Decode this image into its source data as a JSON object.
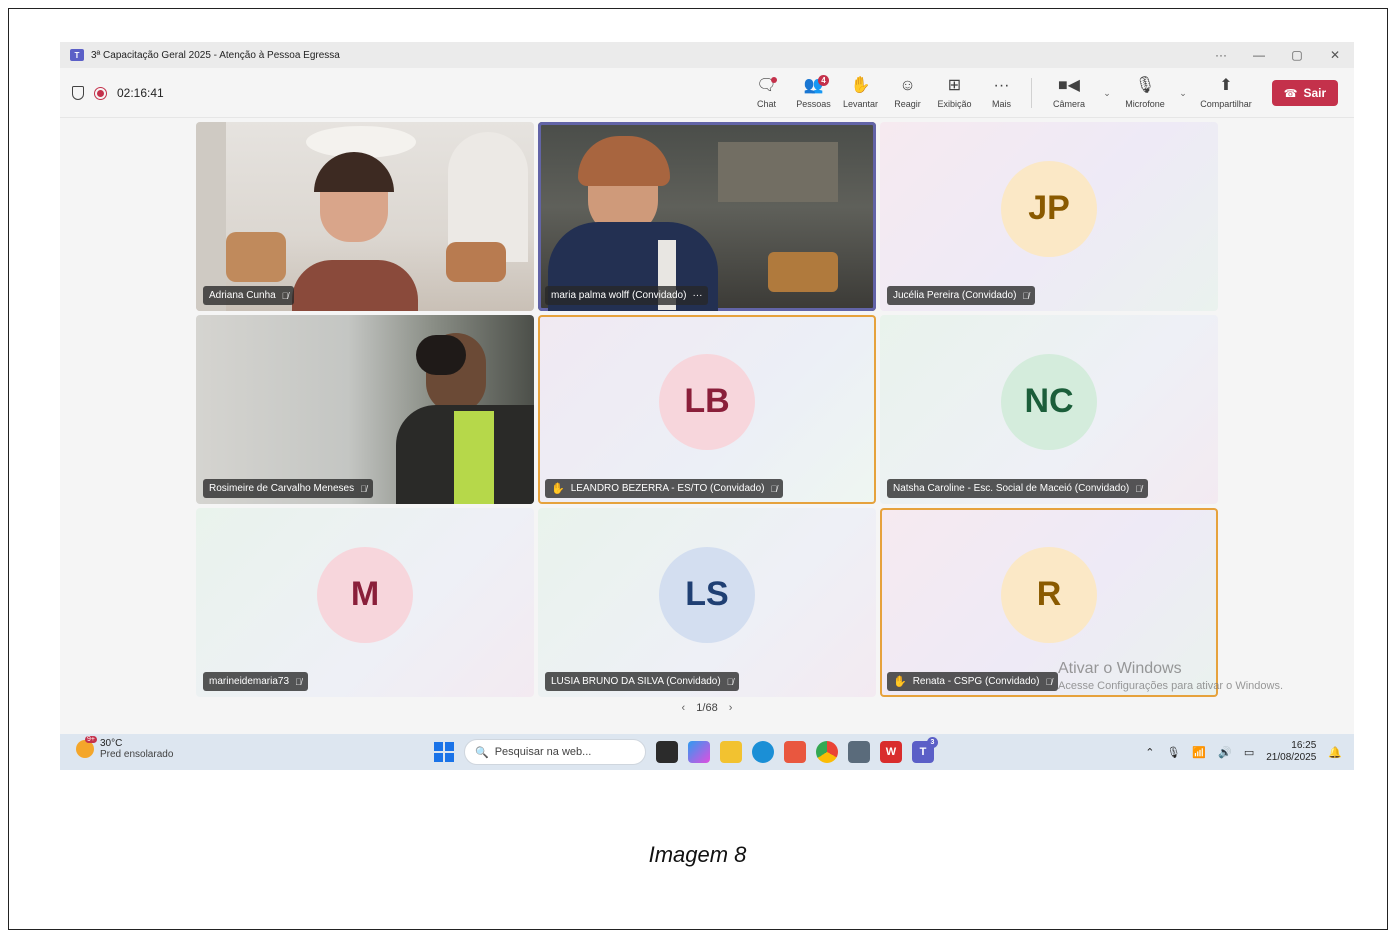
{
  "window": {
    "title": "3ª Capacitação Geral 2025 - Atenção à Pessoa Egressa",
    "controls": [
      "···",
      "—",
      "▢",
      "✕"
    ]
  },
  "meeting": {
    "timer": "02:16:41"
  },
  "toolbar": {
    "chat": "Chat",
    "people": "Pessoas",
    "people_count": "4",
    "raise": "Levantar",
    "react": "Reagir",
    "view": "Exibição",
    "more": "Mais",
    "camera": "Câmera",
    "microphone": "Microfone",
    "share": "Compartilhar",
    "leave": "Sair"
  },
  "participants": [
    {
      "name": "Adriana Cunha",
      "video": true,
      "muted": true,
      "hand": false
    },
    {
      "name": "maria palma wolff (Convidado)",
      "video": true,
      "muted": false,
      "hand": false,
      "active": true
    },
    {
      "name": "Jucélia Pereira (Convidado)",
      "initials": "JP",
      "avatar_bg": "#fbe8c6",
      "avatar_fg": "#8a5a00",
      "muted": true
    },
    {
      "name": "Rosimeire de Carvalho Meneses",
      "video": true,
      "muted": true
    },
    {
      "name": "LEANDRO BEZERRA - ES/TO (Convidado)",
      "initials": "LB",
      "avatar_bg": "#f7d6dc",
      "avatar_fg": "#8a1f3a",
      "muted": true,
      "hand": true
    },
    {
      "name": "Natsha Caroline - Esc. Social de Maceió (Convidado)",
      "initials": "NC",
      "avatar_bg": "#d4ecdc",
      "avatar_fg": "#1b5e3a",
      "muted": true
    },
    {
      "name": "marineidemaria73",
      "initials": "M",
      "avatar_bg": "#f7d6dc",
      "avatar_fg": "#8a1f3a",
      "muted": true
    },
    {
      "name": "LUSIA BRUNO DA SILVA (Convidado)",
      "initials": "LS",
      "avatar_bg": "#d3def0",
      "avatar_fg": "#1f3f73",
      "muted": true
    },
    {
      "name": "Renata - CSPG (Convidado)",
      "initials": "R",
      "avatar_bg": "#fbe8c6",
      "avatar_fg": "#8a5a00",
      "muted": true,
      "hand": true
    }
  ],
  "pager": {
    "label": "1/68",
    "prev": "‹",
    "next": "›"
  },
  "watermark": {
    "title": "Ativar o Windows",
    "subtitle": "Acesse Configurações para ativar o Windows."
  },
  "taskbar": {
    "weather_temp": "30°C",
    "weather_desc": "Pred ensolarado",
    "weather_badge": "9+",
    "search_placeholder": "Pesquisar na web...",
    "teams_badge": "3",
    "time": "16:25",
    "date": "21/08/2025"
  },
  "caption": "Imagem 8",
  "colors": {
    "accent": "#5b5fc7",
    "leave": "#c4314b",
    "hand_border": "#e6a23c"
  }
}
